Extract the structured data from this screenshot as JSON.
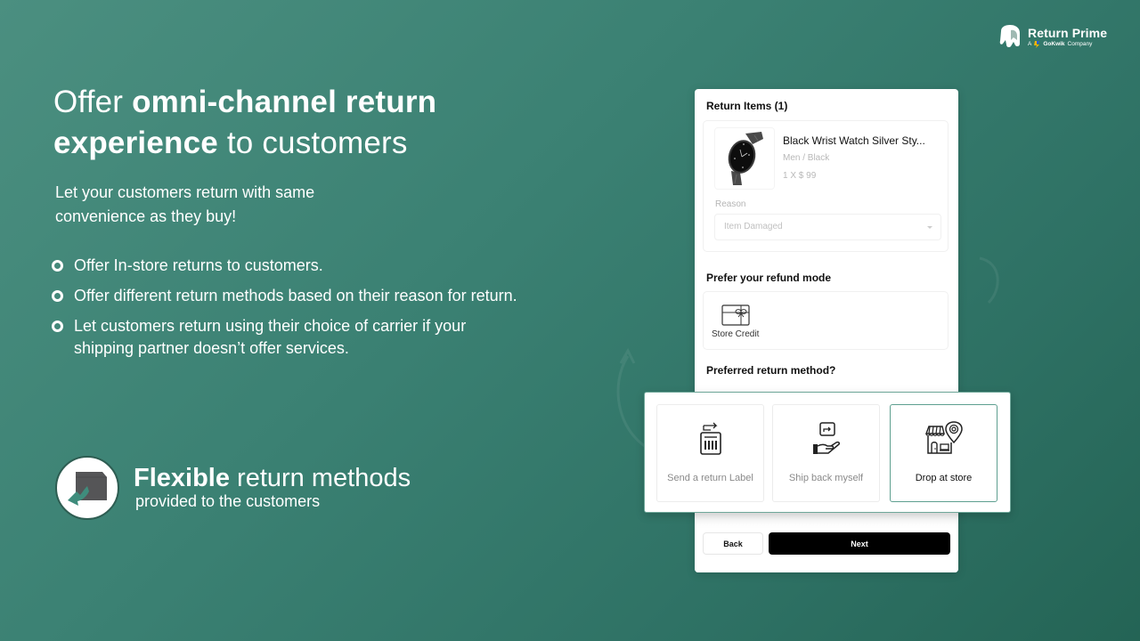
{
  "brand": {
    "name": "Return Prime",
    "tagline_prefix": "A",
    "tagline_company": "GoKwik",
    "tagline_suffix": "Company"
  },
  "hero": {
    "headline_part1": "Offer ",
    "headline_bold1": "omni-channel return",
    "headline_bold2": "experience",
    "headline_part2": " to customers",
    "subheading": "Let your customers return with same convenience as they buy!"
  },
  "bullets": [
    "Offer In-store returns to customers.",
    "Offer different return methods based on their reason for return.",
    "Let customers return using their choice of carrier if your shipping partner doesn’t offer services."
  ],
  "feature": {
    "title_bold": "Flexible",
    "title_rest": " return methods",
    "subtitle": "provided to the customers",
    "icon": "box-return-icon"
  },
  "card": {
    "return_items_title": "Return Items (1)",
    "item": {
      "name": "Black Wrist Watch Silver Sty...",
      "variant": "Men / Black",
      "quantity_price": "1 X $ 99",
      "image": "black-wrist-watch"
    },
    "reason": {
      "label": "Reason",
      "selected": "Item Damaged"
    },
    "refund_mode_title": "Prefer your refund mode",
    "refund_options": [
      {
        "label": "Store Credit",
        "icon": "gift-card-icon"
      }
    ],
    "return_method_title": "Preferred return method?",
    "back_label": "Back",
    "next_label": "Next"
  },
  "return_methods": [
    {
      "label": "Send a return Label",
      "icon": "return-label-icon",
      "selected": false
    },
    {
      "label": "Ship back myself",
      "icon": "ship-back-hand-icon",
      "selected": false
    },
    {
      "label": "Drop at store",
      "icon": "store-location-icon",
      "selected": true
    }
  ],
  "colors": {
    "background_start": "#4b8f80",
    "background_end": "#246455",
    "selected_border": "#5e9f90",
    "button_primary": "#000000"
  }
}
